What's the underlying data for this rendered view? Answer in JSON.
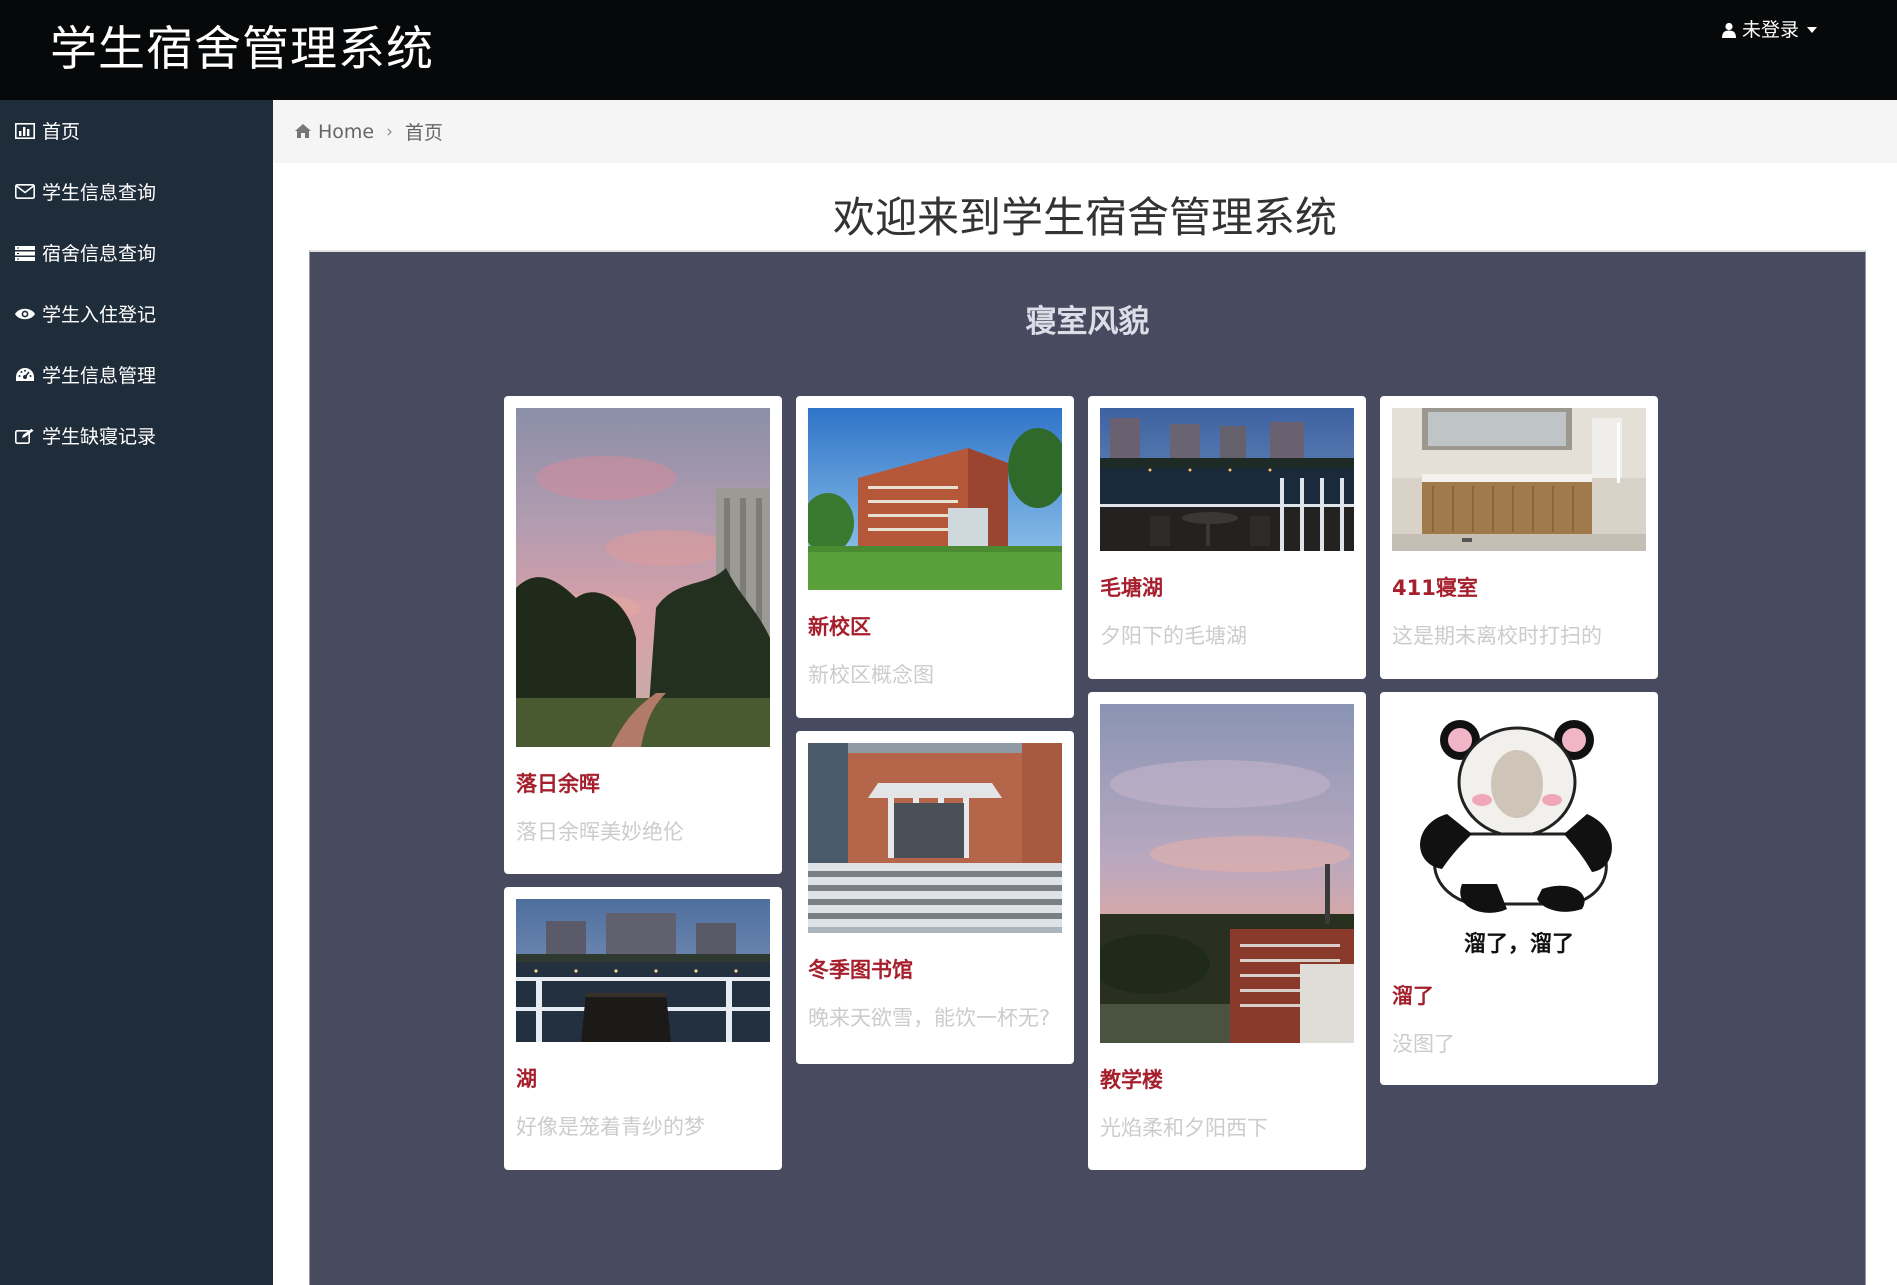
{
  "app": {
    "title": "学生宿舍管理系统",
    "user_menu_label": "未登录"
  },
  "sidebar": {
    "items": [
      {
        "label": "首页",
        "icon": "bar-chart-icon"
      },
      {
        "label": "学生信息查询",
        "icon": "envelope-icon"
      },
      {
        "label": "宿舍信息查询",
        "icon": "list-icon"
      },
      {
        "label": "学生入住登记",
        "icon": "eye-icon"
      },
      {
        "label": "学生信息管理",
        "icon": "dashboard-icon"
      },
      {
        "label": "学生缺寝记录",
        "icon": "edit-icon"
      }
    ]
  },
  "breadcrumb": {
    "home": "Home",
    "current": "首页",
    "separator": "›"
  },
  "main": {
    "welcome": "欢迎来到学生宿舍管理系统",
    "gallery_title": "寝室风貌",
    "cards": [
      {
        "title": "落日余晖",
        "desc": "落日余晖美妙绝伦",
        "image": "sunset-campus-photo"
      },
      {
        "title": "湖",
        "desc": "好像是笼着青纱的梦",
        "image": "lake-evening-photo"
      },
      {
        "title": "新校区",
        "desc": "新校区概念图",
        "image": "new-campus-rendering"
      },
      {
        "title": "冬季图书馆",
        "desc": "晚来天欲雪，能饮一杯无?",
        "image": "winter-library-photo"
      },
      {
        "title": "毛塘湖",
        "desc": "夕阳下的毛塘湖",
        "image": "maotang-lake-photo"
      },
      {
        "title": "教学楼",
        "desc": "光焰柔和夕阳西下",
        "image": "teaching-building-photo"
      },
      {
        "title": "411寝室",
        "desc": "这是期末离校时打扫的",
        "image": "dorm-washroom-photo"
      },
      {
        "title": "溜了",
        "desc": "没图了",
        "image": "panda-meme-image",
        "image_caption": "溜了，溜了"
      }
    ]
  },
  "colors": {
    "topbar": "#070809",
    "sidebar": "#1f2c3a",
    "panel": "#484a60",
    "card_title": "#a61f2c",
    "card_desc": "#cccccc"
  }
}
